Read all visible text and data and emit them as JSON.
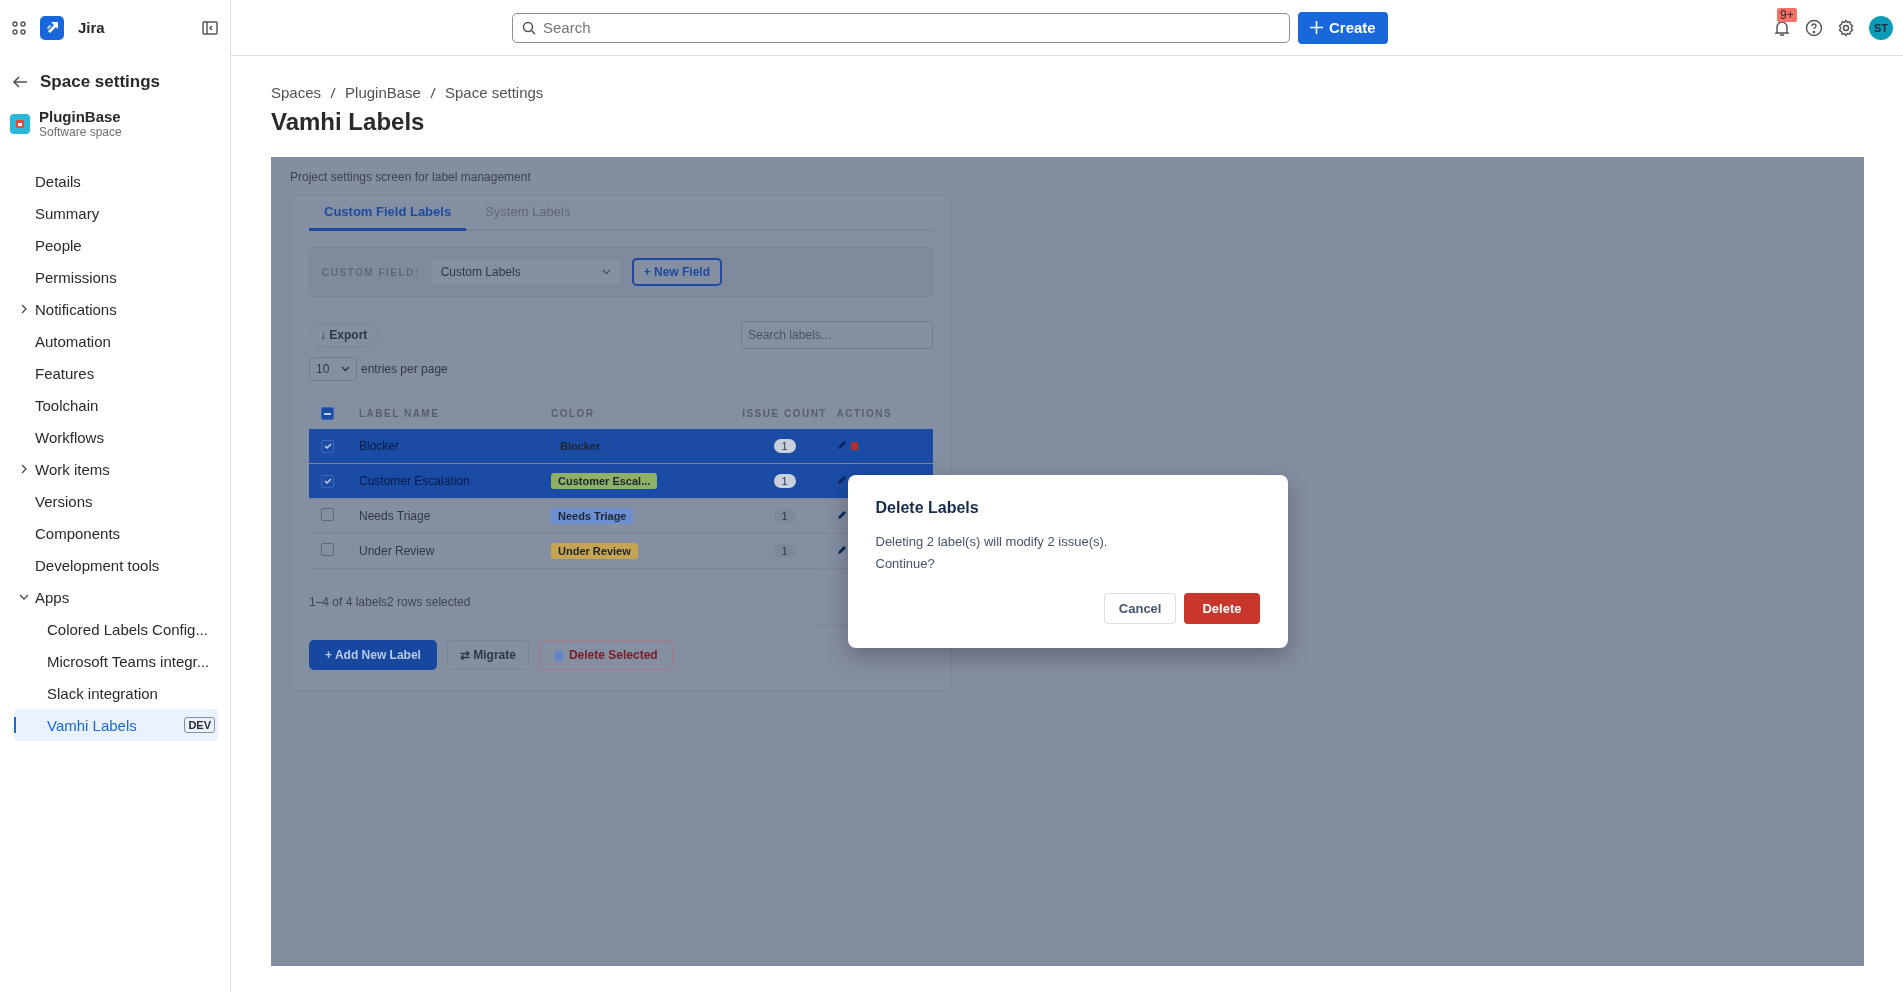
{
  "topbar": {
    "product": "Jira",
    "search": {
      "placeholder": "Search"
    },
    "create_button": "Create",
    "notification_badge": "9+",
    "avatar": "ST"
  },
  "sidebar": {
    "title": "Space settings",
    "space": {
      "name": "PluginBase",
      "type": "Software space"
    },
    "items": [
      {
        "label": "Details",
        "selected": false
      },
      {
        "label": "Summary",
        "selected": false
      },
      {
        "label": "People",
        "selected": false
      },
      {
        "label": "Permissions",
        "selected": false
      },
      {
        "label": "Notifications",
        "selected": false,
        "expanded": false
      },
      {
        "label": "Automation",
        "selected": false
      },
      {
        "label": "Features",
        "selected": false
      },
      {
        "label": "Toolchain",
        "selected": false
      },
      {
        "label": "Workflows",
        "selected": false
      },
      {
        "label": "Work items",
        "selected": false,
        "expanded": false
      },
      {
        "label": "Versions",
        "selected": false
      },
      {
        "label": "Components",
        "selected": false
      },
      {
        "label": "Development tools",
        "selected": false
      },
      {
        "label": "Apps",
        "selected": false,
        "expanded": true,
        "children": [
          {
            "label": "Colored Labels Config...",
            "selected": false
          },
          {
            "label": "Microsoft Teams integr...",
            "selected": false
          },
          {
            "label": "Slack integration",
            "selected": false
          },
          {
            "label": "Vamhi Labels",
            "selected": true,
            "badge": "DEV"
          }
        ]
      }
    ]
  },
  "breadcrumbs": [
    "Spaces",
    "PluginBase",
    "Space settings"
  ],
  "page_title": "Vamhi Labels",
  "app": {
    "subtitle": "Project settings screen for label management",
    "tabs": [
      {
        "label": "Custom Field Labels",
        "selected": true
      },
      {
        "label": "System Labels",
        "selected": false
      }
    ],
    "custom_field": {
      "label": "CUSTOM FIELD:",
      "value": "Custom Labels",
      "button": "+ New Field"
    },
    "export_button": "↓ Export",
    "search": {
      "placeholder": "Search labels..."
    },
    "page_size": {
      "value": "10",
      "label": "entries per page"
    },
    "table": {
      "select_all_indeterminate": true,
      "columns": [
        "LABEL NAME",
        "COLOR",
        "ISSUE COUNT",
        "ACTIONS"
      ],
      "rows": [
        {
          "name": "Blocker",
          "tag": "Blocker",
          "color": "#1c4f9a",
          "outlined": true,
          "issue_count": "1",
          "selected": true
        },
        {
          "name": "Customer Escalation",
          "tag": "Customer Escal...",
          "color": "#8fb067",
          "outlined": false,
          "issue_count": "1",
          "selected": true
        },
        {
          "name": "Needs Triage",
          "tag": "Needs Triage",
          "color": "#6d8fd2",
          "outlined": false,
          "issue_count": "1",
          "selected": false
        },
        {
          "name": "Under Review",
          "tag": "Under Review",
          "color": "#c6a552",
          "outlined": false,
          "issue_count": "1",
          "selected": false
        }
      ]
    },
    "summary": "1–4 of 4 labels2 rows selected",
    "actions": {
      "add": "+ Add New Label",
      "migrate": "⇄ Migrate",
      "delete": "Delete Selected"
    }
  },
  "dialog": {
    "title": "Delete Labels",
    "lines": [
      "Deleting 2 label(s) will modify 2 issue(s).",
      "Continue?"
    ],
    "cancel": "Cancel",
    "confirm": "Delete"
  }
}
